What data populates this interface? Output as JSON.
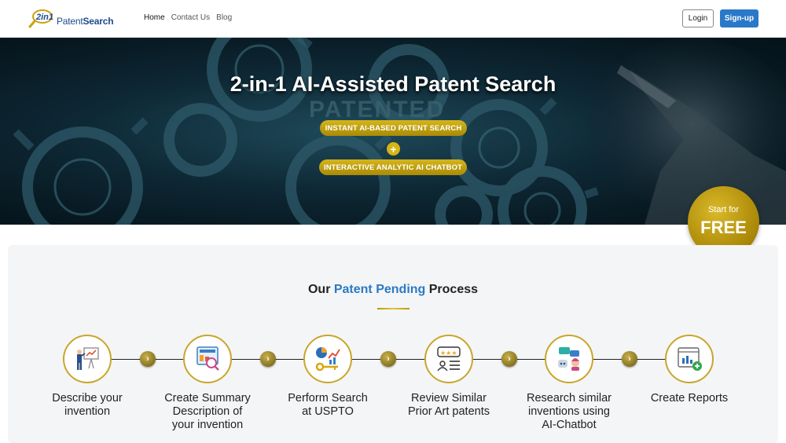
{
  "nav": {
    "logo_mark": "2in1",
    "logo_text_prefix": "Patent",
    "logo_text_bold": "Search",
    "links": [
      {
        "label": "Home",
        "active": true
      },
      {
        "label": "Contact Us",
        "active": false
      },
      {
        "label": "Blog",
        "active": false
      }
    ],
    "login_label": "Login",
    "signup_label": "Sign-up"
  },
  "hero": {
    "title": "2-in-1 AI-Assisted Patent Search",
    "pill_1": "INSTANT AI-BASED PATENT SEARCH",
    "plus": "+",
    "pill_2": "INTERACTIVE ANALYTIC AI CHATBOT",
    "bg_word": "PATENTED",
    "cta_small": "Start for",
    "cta_big": "FREE"
  },
  "process": {
    "title_prefix": "Our ",
    "title_highlight": "Patent Pending",
    "title_suffix": " Process",
    "arrow_glyph": "›",
    "steps": [
      {
        "label_lines": [
          "Describe your",
          "invention"
        ],
        "icon": "presenter-icon"
      },
      {
        "label_lines": [
          "Create Summary",
          "Description of",
          "your invention"
        ],
        "icon": "document-magnifier-icon"
      },
      {
        "label_lines": [
          "Perform Search",
          "at USPTO"
        ],
        "icon": "chart-key-icon"
      },
      {
        "label_lines": [
          "Review Similar",
          "Prior Art patents"
        ],
        "icon": "rating-review-icon"
      },
      {
        "label_lines": [
          "Research similar",
          "inventions using",
          "AI-Chatbot"
        ],
        "icon": "chatbot-icon"
      },
      {
        "label_lines": [
          "Create Reports"
        ],
        "icon": "report-add-icon"
      }
    ]
  },
  "colors": {
    "accent_blue": "#2a78c8",
    "gold": "#c8a62a",
    "hero_bg": "#0e2835"
  }
}
